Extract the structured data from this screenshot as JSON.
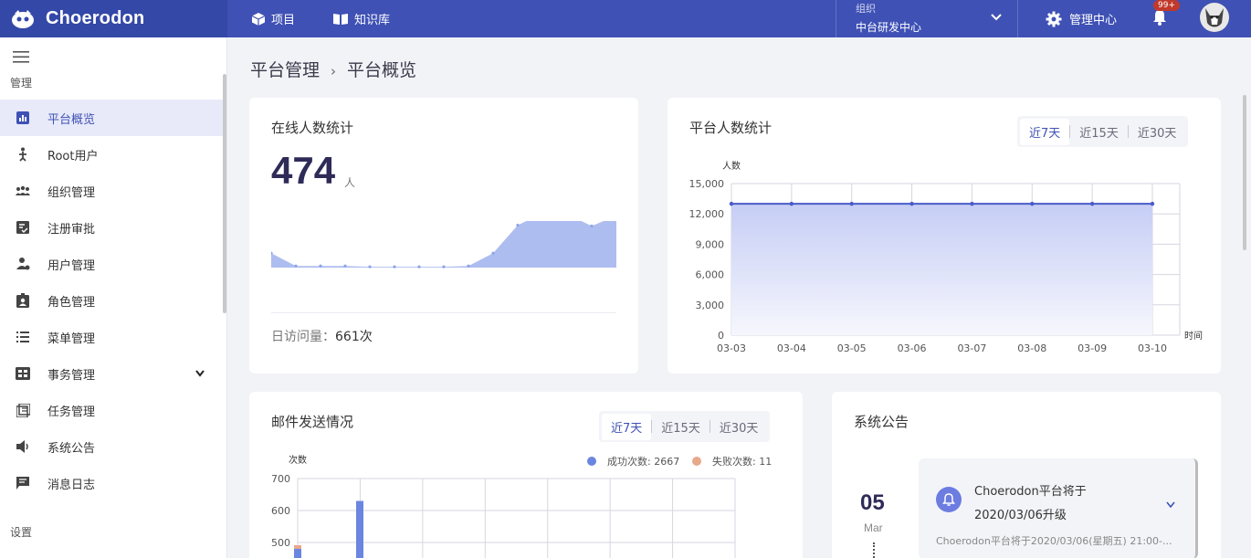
{
  "brand": {
    "name": "Choerodon"
  },
  "topnav": {
    "projects": "项目",
    "knowledge": "知识库",
    "admin_center": "管理中心",
    "badge": "99+"
  },
  "org": {
    "label": "组织",
    "value": "中台研发中心"
  },
  "sidebar": {
    "section_manage": "管理",
    "section_settings": "设置",
    "items": [
      {
        "label": "平台概览",
        "icon": "bar-chart-icon",
        "active": true
      },
      {
        "label": "Root用户",
        "icon": "root-user-icon"
      },
      {
        "label": "组织管理",
        "icon": "org-icon"
      },
      {
        "label": "注册审批",
        "icon": "approval-icon"
      },
      {
        "label": "用户管理",
        "icon": "user-manage-icon"
      },
      {
        "label": "角色管理",
        "icon": "role-icon"
      },
      {
        "label": "菜单管理",
        "icon": "menu-list-icon"
      },
      {
        "label": "事务管理",
        "icon": "transaction-icon",
        "expandable": true
      },
      {
        "label": "任务管理",
        "icon": "task-icon"
      },
      {
        "label": "系统公告",
        "icon": "announce-icon"
      },
      {
        "label": "消息日志",
        "icon": "message-log-icon"
      }
    ]
  },
  "breadcrumb": {
    "parent": "平台管理",
    "sep": "›",
    "current": "平台概览"
  },
  "online": {
    "title": "在线人数统计",
    "count": "474",
    "unit": "人",
    "visits_label": "日访问量：",
    "visits_value": "661次"
  },
  "platform": {
    "title": "平台人数统计",
    "ranges": [
      "近7天",
      "近15天",
      "近30天"
    ]
  },
  "mail": {
    "title": "邮件发送情况",
    "ranges": [
      "近7天",
      "近15天",
      "近30天"
    ],
    "legend_success": "成功次数: 2667",
    "legend_fail": "失败次数: 11"
  },
  "announce": {
    "title": "系统公告",
    "day": "05",
    "month": "Mar",
    "headline": "Choerodon平台将于2020/03/06升级",
    "headline_l1": "Choerodon平台将于",
    "headline_l2": "2020/03/06升级",
    "summary": "Choerodon平台将于2020/03/06(星期五) 21:00-..."
  },
  "colors": {
    "primary": "#3f51b5",
    "success": "#6b86e0",
    "fail": "#e8a98a"
  },
  "chart_data": [
    {
      "type": "area",
      "title": "在线人数统计",
      "x": [
        0,
        1,
        2,
        3,
        4,
        5,
        6,
        7,
        8,
        9,
        10,
        11,
        12,
        13,
        14
      ],
      "values": [
        18,
        2,
        2,
        2,
        1,
        1,
        1,
        1,
        2,
        18,
        53,
        68,
        67,
        52,
        65
      ],
      "ylim": [
        0,
        80
      ]
    },
    {
      "type": "line",
      "title": "平台人数统计",
      "ylabel": "人数",
      "xlabel": "时间",
      "categories": [
        "03-03",
        "03-04",
        "03-05",
        "03-06",
        "03-07",
        "03-08",
        "03-09",
        "03-10"
      ],
      "values": [
        13000,
        13000,
        13000,
        13000,
        13000,
        13000,
        13000,
        13000
      ],
      "ylim": [
        0,
        15000
      ],
      "yticks": [
        "0",
        "3,000",
        "6,000",
        "9,000",
        "12,000",
        "15,000"
      ]
    },
    {
      "type": "bar",
      "title": "邮件发送情况",
      "ylabel": "次数",
      "yticks_visible": [
        "500",
        "600",
        "700"
      ],
      "series": [
        {
          "name": "成功次数",
          "values": [
            480,
            630
          ]
        },
        {
          "name": "失败次数",
          "values": [
            5,
            0
          ]
        }
      ]
    }
  ]
}
